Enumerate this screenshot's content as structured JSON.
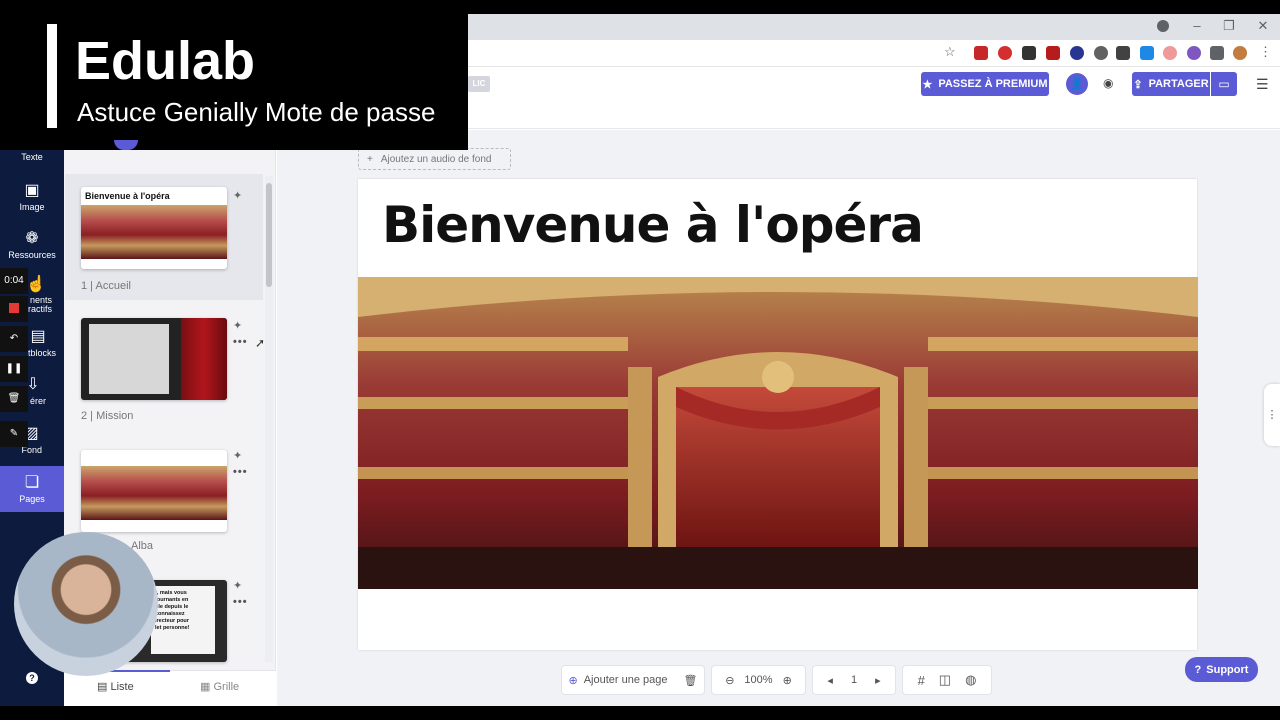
{
  "overlay": {
    "title": "Edulab",
    "subtitle": "Astuce Genially Mote de passe"
  },
  "header": {
    "public_badge": "LIC",
    "premium_label": "PASSEZ À PREMIUM",
    "share_label": "PARTAGER"
  },
  "toolbar": {
    "items": [
      {
        "label": "Texte",
        "icon": "text-icon"
      },
      {
        "label": "Image",
        "icon": "image-icon"
      },
      {
        "label": "Ressources",
        "icon": "resources-icon"
      },
      {
        "label": "nents\nractifs",
        "icon": "interactive-icon"
      },
      {
        "label": "tblocks",
        "icon": "smartblocks-icon"
      },
      {
        "label": "érer",
        "icon": "insert-icon"
      },
      {
        "label": "Fond",
        "icon": "background-icon"
      },
      {
        "label": "Pages",
        "icon": "pages-icon"
      }
    ],
    "help": "?"
  },
  "recorder": {
    "time": "0:04"
  },
  "pages": [
    {
      "num": "1",
      "name": "Accueil",
      "thumb_title": "Bienvenue à l'opéra"
    },
    {
      "num": "2",
      "name": "Mission"
    },
    {
      "num": "",
      "name": "Alba"
    },
    {
      "num": "",
      "name": ""
    }
  ],
  "thumb_text": {
    "tv": "r, mais vous\nfournants en\nble depuis le\nconnaissez\nirecteur pour\nlet personne!"
  },
  "tabs": {
    "list": "Liste",
    "grid": "Grille"
  },
  "canvas": {
    "audio_label": "Ajoutez un audio de fond",
    "title": "Bienvenue à l'opéra"
  },
  "bottombar": {
    "add_page": "Ajouter une page",
    "zoom": "100%",
    "page": "1"
  },
  "support_label": "Support",
  "colors": {
    "accent": "#5b5bd6",
    "toolbar": "#0d1b3e"
  }
}
